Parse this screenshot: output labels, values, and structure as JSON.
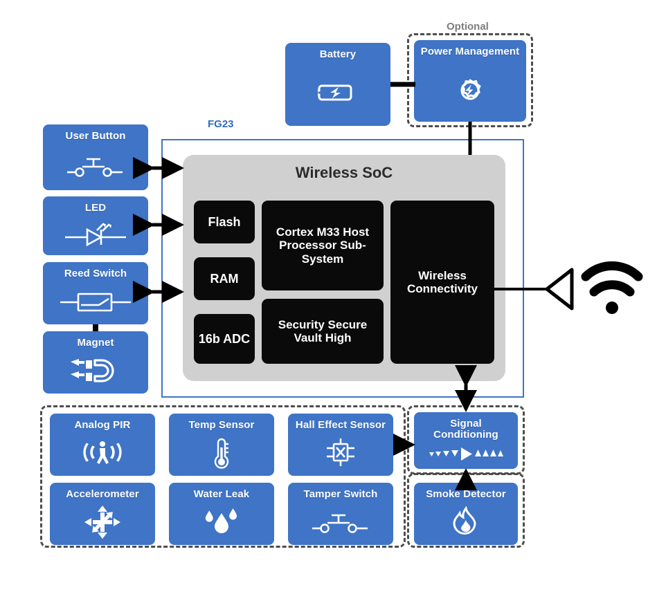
{
  "diagram": {
    "title_region_label": "FG23",
    "optional_label": "Optional",
    "soc_title": "Wireless SoC"
  },
  "colors": {
    "box_blue": "#3f74c6",
    "fg23_outline": "#3f74c6",
    "soc_panel": "#d0d0d0",
    "ip_block": "#0a0a0a",
    "dashed_border": "#4d4d4d",
    "optional_text": "#7d7d7d",
    "fg23_text": "#2f6bc0"
  },
  "power": {
    "battery": {
      "label": "Battery",
      "icon": "battery-charge-icon"
    },
    "power_management": {
      "label": "Power Management",
      "icon": "gear-power-icon"
    }
  },
  "peripherals_left": [
    {
      "label": "User Button",
      "icon": "push-button-switch-icon",
      "link": "bidirectional"
    },
    {
      "label": "LED",
      "icon": "led-diode-icon",
      "link": "bidirectional"
    },
    {
      "label": "Reed Switch",
      "icon": "reed-switch-icon",
      "link": "bidirectional"
    },
    {
      "label": "Magnet",
      "icon": "magnet-icon",
      "link": "magnet-to-reed"
    }
  ],
  "soc": {
    "title": "Wireless SoC",
    "memory_blocks": [
      {
        "label": "Flash"
      },
      {
        "label": "RAM"
      },
      {
        "label": "16b ADC"
      }
    ],
    "core_blocks": [
      {
        "label": "Cortex M33 Host Processor Sub-System"
      },
      {
        "label": "Security Secure Vault High"
      }
    ],
    "radio_block": {
      "label": "Wireless Connectivity"
    }
  },
  "antenna": {
    "icon": "antenna-icon",
    "waves_icon": "wireless-waves-icon"
  },
  "sensors": {
    "analog_group_rows": [
      [
        {
          "label": "Analog PIR",
          "icon": "pir-motion-icon"
        },
        {
          "label": "Temp Sensor",
          "icon": "thermometer-icon"
        },
        {
          "label": "Hall Effect Sensor",
          "icon": "hall-effect-icon"
        }
      ],
      [
        {
          "label": "Accelerometer",
          "icon": "accelerometer-axes-icon"
        },
        {
          "label": "Water Leak",
          "icon": "water-droplets-icon"
        },
        {
          "label": "Tamper Switch",
          "icon": "push-button-switch-icon"
        }
      ]
    ],
    "smoke_detector": {
      "label": "Smoke Detector",
      "icon": "flame-icon"
    },
    "signal_conditioning": {
      "label": "Signal Conditioning",
      "icon": "signal-amplifier-icon"
    }
  }
}
